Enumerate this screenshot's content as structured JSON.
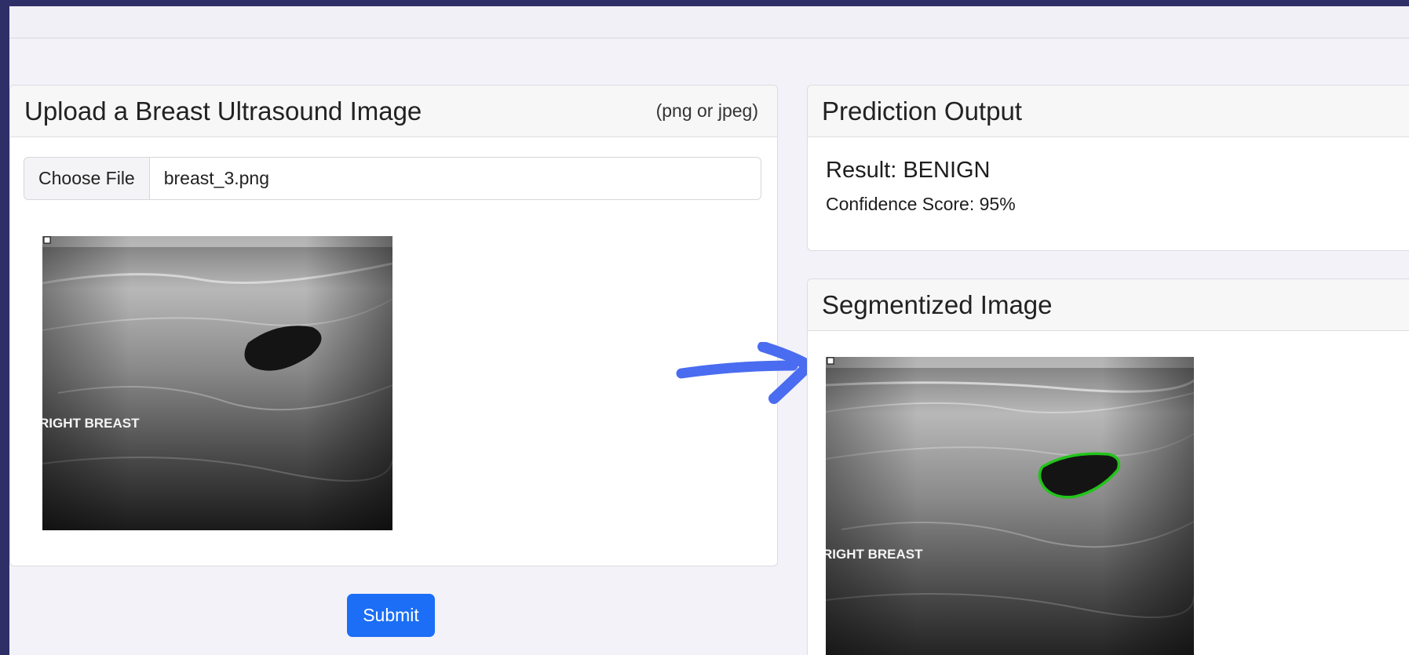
{
  "upload_card": {
    "title": "Upload a Breast Ultrasound Image",
    "hint": "(png or jpeg)",
    "file_button": "Choose File",
    "file_name": "breast_3.png",
    "image_label": "RIGHT BREAST"
  },
  "submit_label": "Submit",
  "prediction_card": {
    "title": "Prediction Output",
    "result": "Result: BENIGN",
    "confidence": "Confidence Score: 95%"
  },
  "segmented_card": {
    "title": "Segmentized Image",
    "image_label": "RIGHT BREAST",
    "contour_color": "#22c41a"
  },
  "colors": {
    "page_border": "#2f2f68",
    "button": "#1b6ef5",
    "arrow": "#4a6cf0"
  },
  "icons": {
    "annotation_arrow": "right-arrow-icon"
  }
}
